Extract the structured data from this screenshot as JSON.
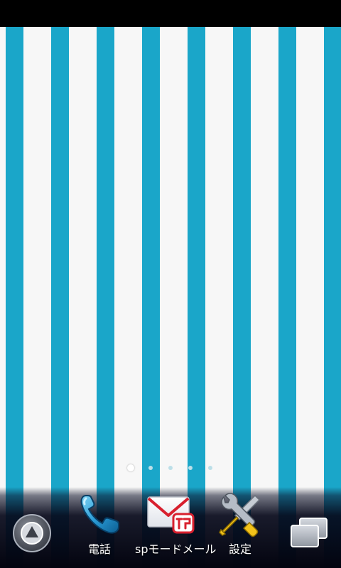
{
  "home_screen": {
    "page_indicator": {
      "page_count": 5,
      "current_page": 1
    },
    "dock": {
      "apps": [
        {
          "label": "電話",
          "icon": "phone-icon"
        },
        {
          "label": "spモードメール",
          "icon": "sp-mode-mail-icon"
        },
        {
          "label": "設定",
          "icon": "settings-icon"
        }
      ],
      "launcher_icon": "app-launcher-icon",
      "recent_icon": "recent-apps-icon"
    },
    "colors": {
      "stripe_blue": "#1aa6c9",
      "stripe_white": "#f7f7f7",
      "dock_bg": "#03040f",
      "mail_red": "#d8202e",
      "phone_blue": "#2a9bd6"
    }
  }
}
